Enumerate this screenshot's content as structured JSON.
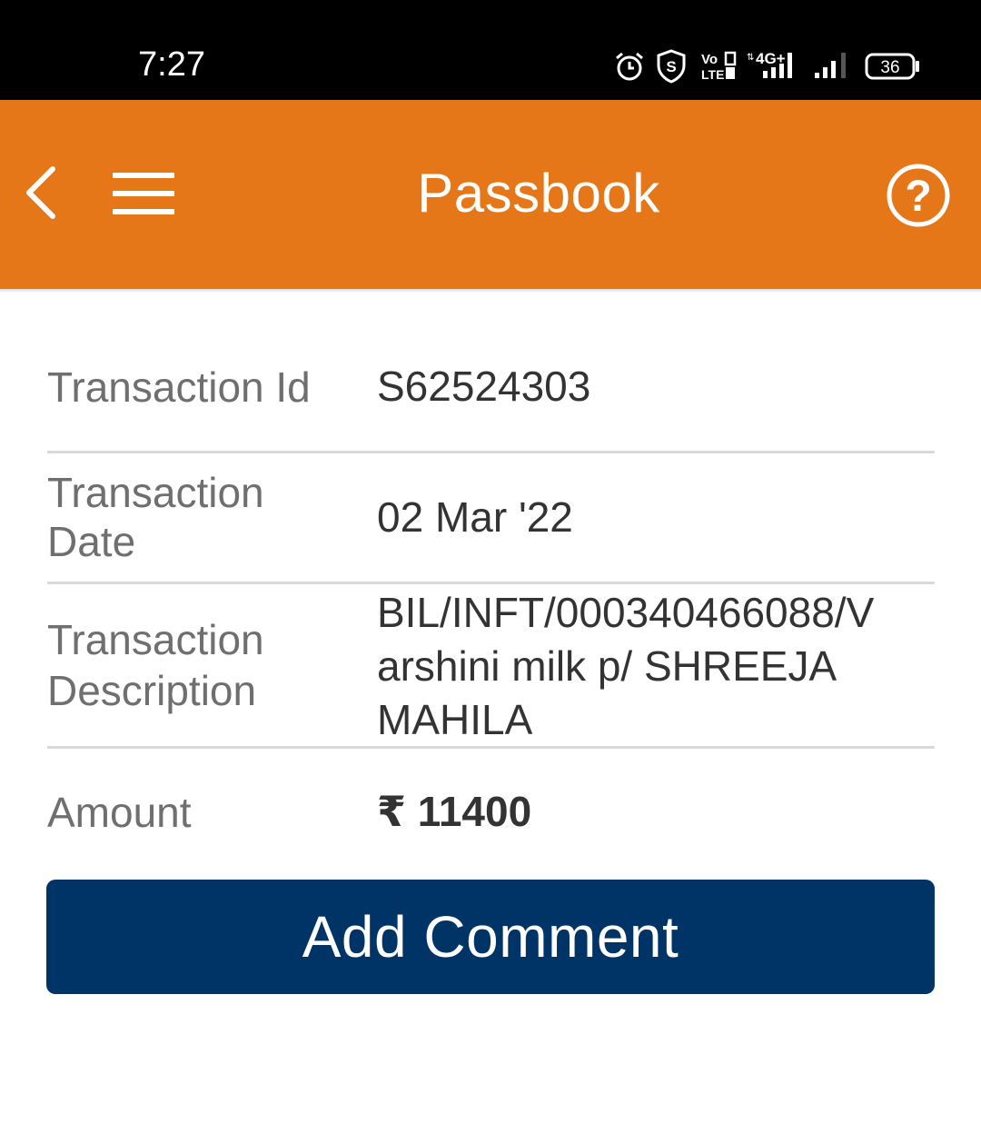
{
  "status_bar": {
    "time": "7:27",
    "network_label": "4G+",
    "volte_label": "Vo LTE 2",
    "battery_level": "36",
    "icons": [
      "alarm-icon",
      "shield-s-icon",
      "volte-icon",
      "signal-4g-icon",
      "signal-icon",
      "battery-icon"
    ]
  },
  "header": {
    "title": "Passbook",
    "background_color": "#e57718",
    "icons": [
      "back-chevron-icon",
      "hamburger-menu-icon",
      "help-question-icon"
    ]
  },
  "transaction": {
    "id_label": "Transaction Id",
    "id_value": "S62524303",
    "date_label_line1": "Transaction",
    "date_label_line2": "Date",
    "date_value": "02 Mar '22",
    "description_label_line1": "Transaction",
    "description_label_line2": "Description",
    "description_line1": "BIL/INFT/000340466088/V",
    "description_line2": "arshini milk p/ SHREEJA",
    "description_line3": "MAHILA",
    "amount_label": "Amount",
    "amount_currency": "₹",
    "amount_value": "11400"
  },
  "actions": {
    "add_comment_label": "Add Comment",
    "button_color": "#003366"
  }
}
